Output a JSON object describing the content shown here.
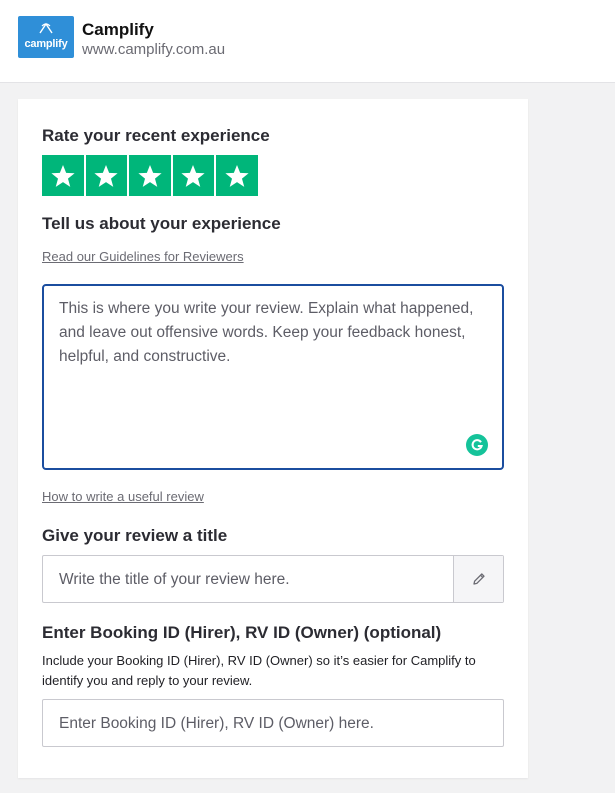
{
  "company": {
    "logo_text": "camplify",
    "name": "Camplify",
    "url": "www.camplify.com.au"
  },
  "rating": {
    "heading": "Rate your recent experience",
    "stars": 5,
    "max_stars": 5,
    "star_color": "#00b67a"
  },
  "review": {
    "heading": "Tell us about your experience",
    "guidelines_link": "Read our Guidelines for Reviewers",
    "placeholder": "This is where you write your review. Explain what happened, and leave out offensive words. Keep your feedback honest, helpful, and constructive.",
    "useful_link": "How to write a useful review",
    "grammarly_icon": "grammarly-icon"
  },
  "title_field": {
    "heading": "Give your review a title",
    "placeholder": "Write the title of your review here.",
    "icon": "pencil-icon"
  },
  "booking_field": {
    "heading": "Enter Booking ID (Hirer), RV ID (Owner) (optional)",
    "helper": "Include your Booking ID (Hirer), RV ID (Owner) so it’s easier for Camplify to identify you and reply to your review.",
    "placeholder": "Enter Booking ID (Hirer), RV ID (Owner) here."
  },
  "colors": {
    "accent_border": "#1b4d9f",
    "brand_blue": "#2f8fd8",
    "grammarly_green": "#15c39a"
  }
}
